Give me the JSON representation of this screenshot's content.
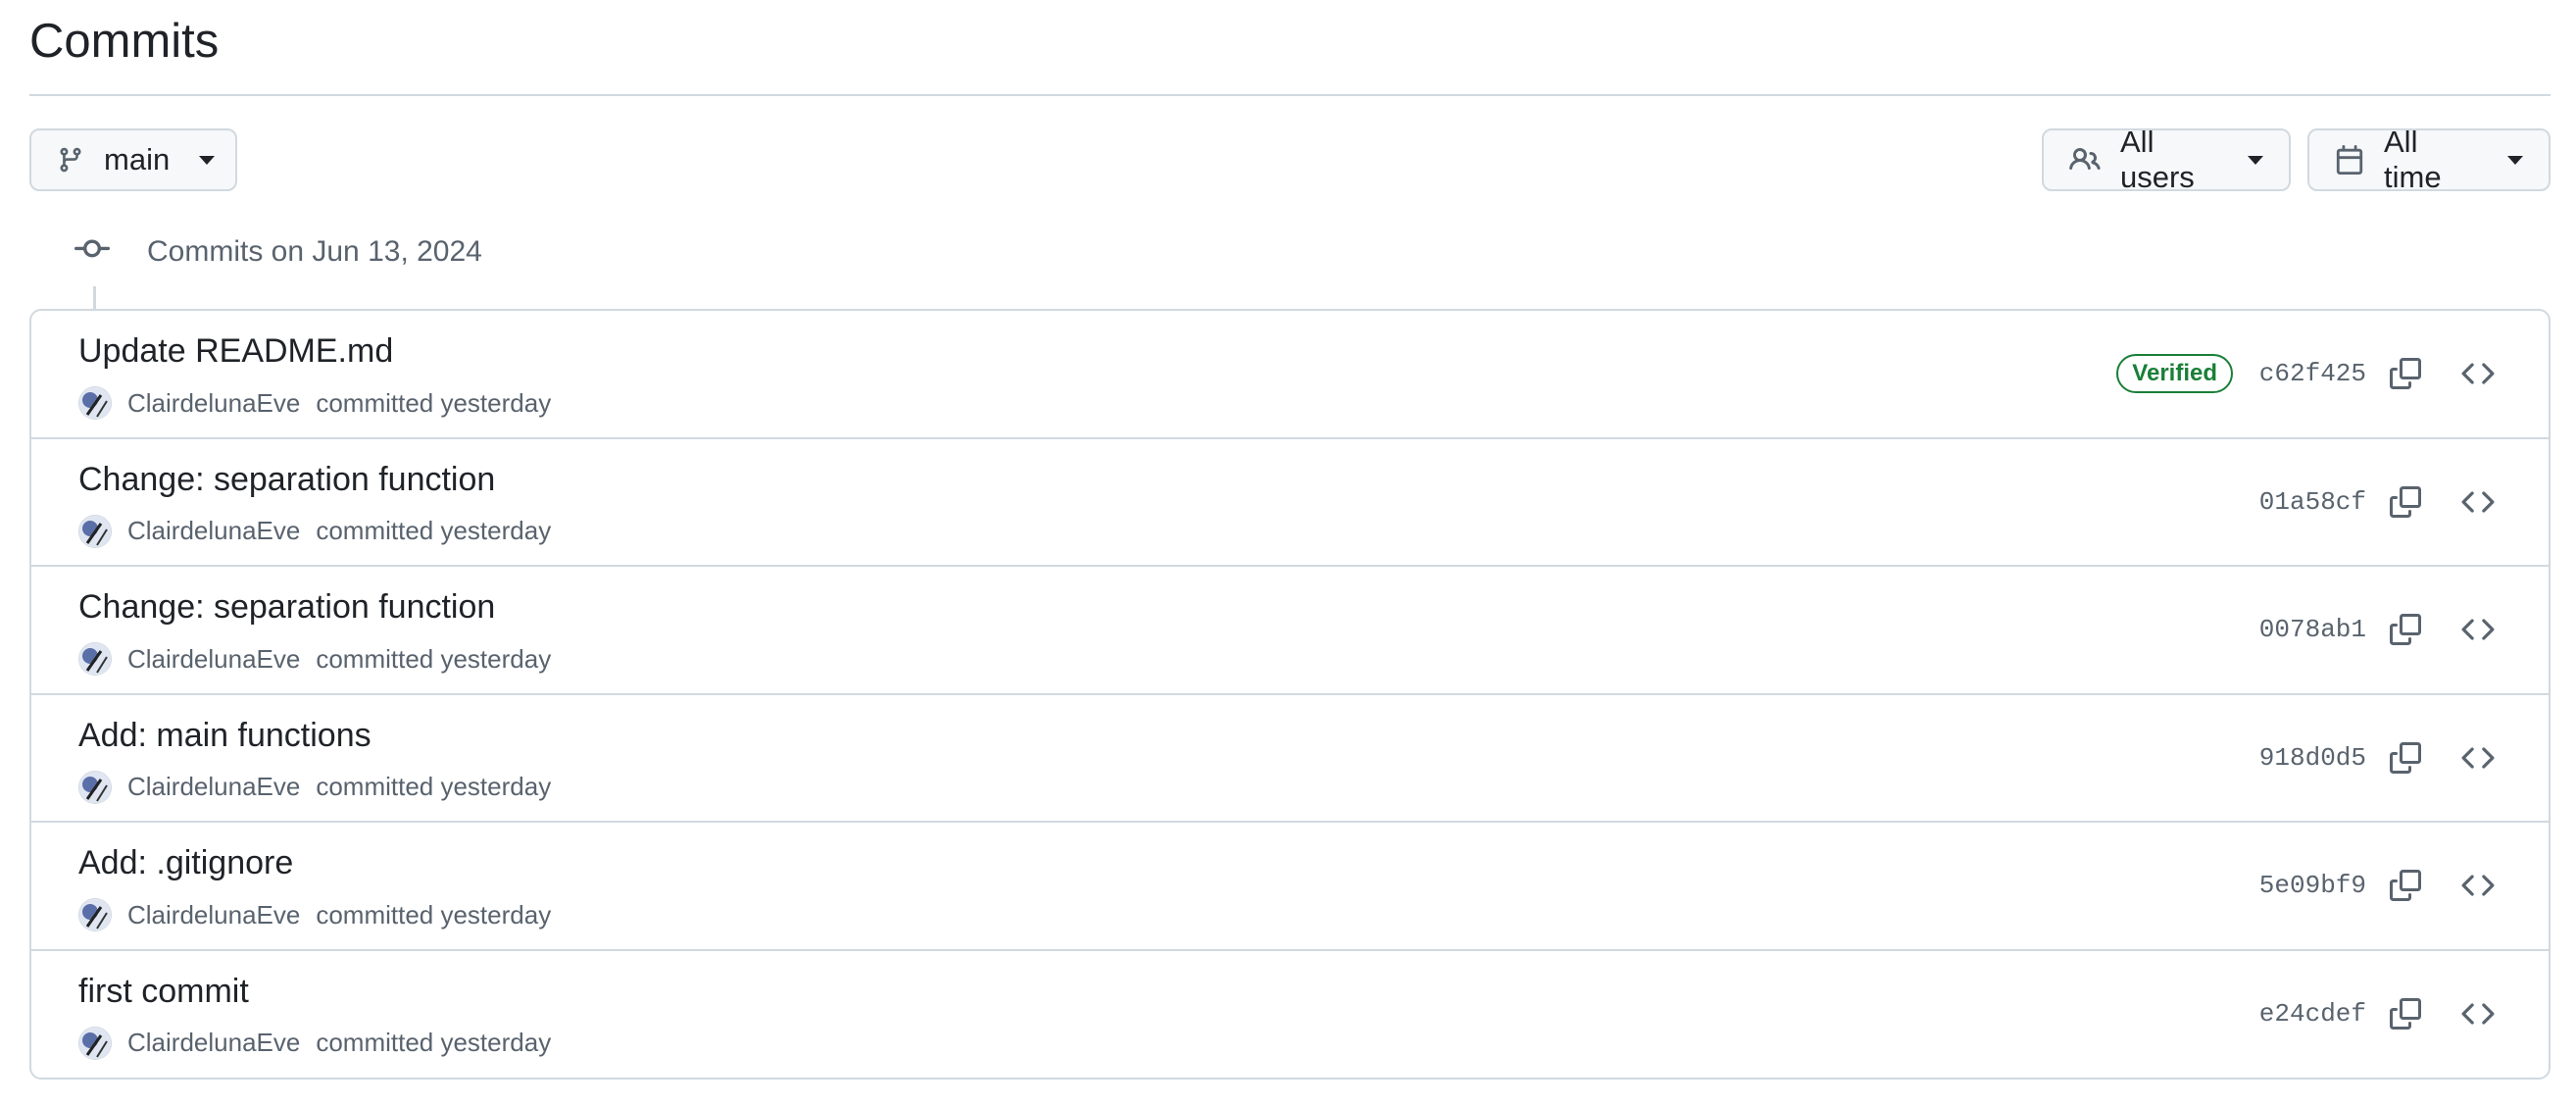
{
  "page": {
    "title": "Commits"
  },
  "filters": {
    "branch": {
      "label": "main",
      "icon": "git-branch-icon"
    },
    "users": {
      "label": "All users",
      "icon": "people-icon"
    },
    "time": {
      "label": "All time",
      "icon": "calendar-icon"
    }
  },
  "day_group": {
    "label": "Commits on Jun 13, 2024",
    "icon": "git-commit-icon"
  },
  "commits": [
    {
      "title": "Update README.md",
      "author": "ClairdelunaEve",
      "meta": "committed yesterday",
      "sha": "c62f425",
      "verified": "Verified"
    },
    {
      "title": "Change: separation function",
      "author": "ClairdelunaEve",
      "meta": "committed yesterday",
      "sha": "01a58cf"
    },
    {
      "title": "Change: separation function",
      "author": "ClairdelunaEve",
      "meta": "committed yesterday",
      "sha": "0078ab1"
    },
    {
      "title": "Add: main functions",
      "author": "ClairdelunaEve",
      "meta": "committed yesterday",
      "sha": "918d0d5"
    },
    {
      "title": "Add: .gitignore",
      "author": "ClairdelunaEve",
      "meta": "committed yesterday",
      "sha": "5e09bf9"
    },
    {
      "title": "first commit",
      "author": "ClairdelunaEve",
      "meta": "committed yesterday",
      "sha": "e24cdef"
    }
  ],
  "colors": {
    "text": "#1f2328",
    "muted": "#59636e",
    "border": "#d1d9e0",
    "verified": "#1a7f37",
    "button_bg": "#f6f8fa"
  }
}
